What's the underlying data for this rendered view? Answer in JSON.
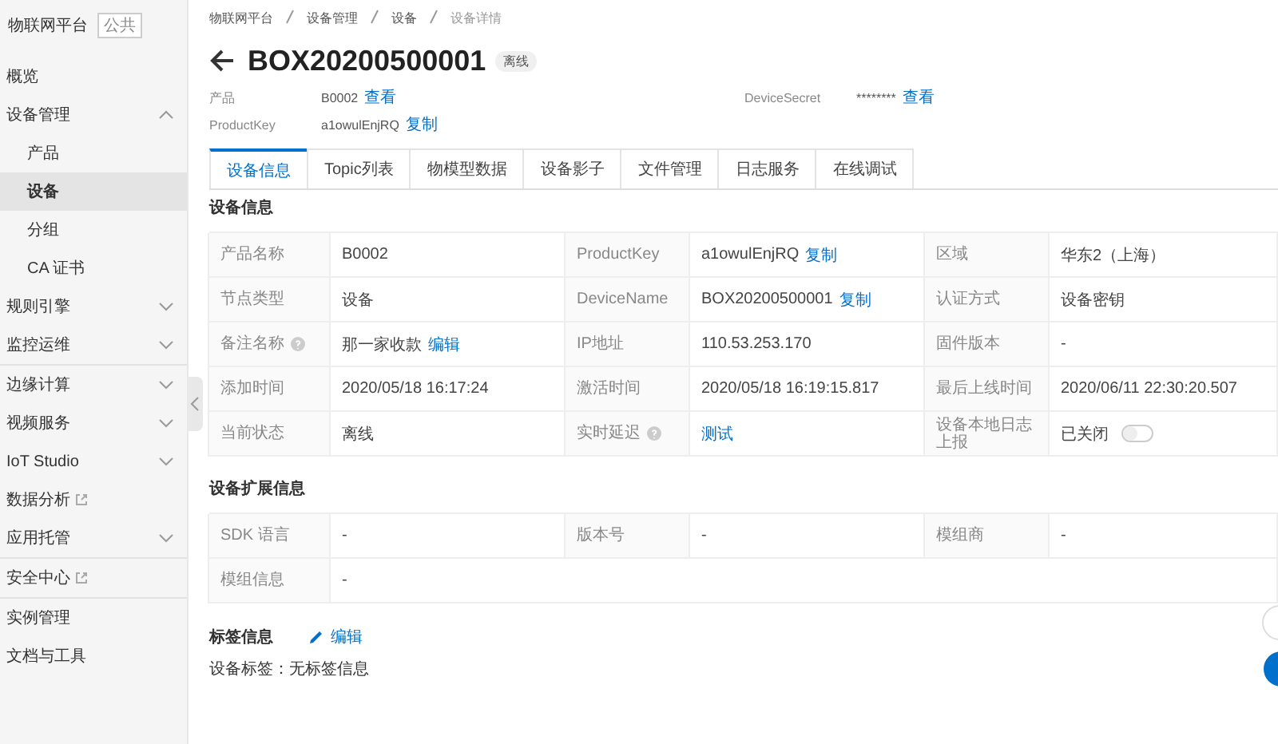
{
  "sidebar": {
    "platform": "物联网平台",
    "platform_badge": "公共",
    "sections": [
      [
        {
          "label": "概览",
          "selected": false
        },
        {
          "label": "设备管理",
          "selected": false,
          "expanded": true,
          "children": [
            {
              "label": "产品",
              "selected": false
            },
            {
              "label": "设备",
              "selected": true
            },
            {
              "label": "分组",
              "selected": false
            },
            {
              "label": "CA 证书",
              "selected": false
            }
          ]
        },
        {
          "label": "规则引擎",
          "selected": false,
          "expanded": false
        },
        {
          "label": "监控运维",
          "selected": false,
          "expanded": false
        }
      ],
      [
        {
          "label": "边缘计算",
          "selected": false,
          "expanded": false
        },
        {
          "label": "视频服务",
          "selected": false,
          "expanded": false
        },
        {
          "label": "IoT Studio",
          "selected": false,
          "expanded": false
        },
        {
          "label": "数据分析",
          "selected": false,
          "external": true
        },
        {
          "label": "应用托管",
          "selected": false,
          "expanded": false
        }
      ],
      [
        {
          "label": "安全中心",
          "selected": false,
          "external": true
        }
      ],
      [
        {
          "label": "实例管理",
          "selected": false
        },
        {
          "label": "文档与工具",
          "selected": false
        }
      ]
    ]
  },
  "breadcrumb": [
    "物联网平台",
    "设备管理",
    "设备",
    "设备详情"
  ],
  "title": "BOX20200500001",
  "status_badge": "离线",
  "meta": [
    {
      "label": "产品",
      "value": "B0002",
      "action": "查看"
    },
    {
      "label": "DeviceSecret",
      "value": "********",
      "action": "查看"
    },
    {
      "label": "ProductKey",
      "value": "a1owulEnjRQ",
      "action": "复制"
    }
  ],
  "tabs": [
    {
      "label": "设备信息",
      "selected": true
    },
    {
      "label": "Topic列表",
      "selected": false
    },
    {
      "label": "物模型数据",
      "selected": false
    },
    {
      "label": "设备影子",
      "selected": false
    },
    {
      "label": "文件管理",
      "selected": false
    },
    {
      "label": "日志服务",
      "selected": false
    },
    {
      "label": "在线调试",
      "selected": false
    }
  ],
  "device_info": {
    "title": "设备信息",
    "rows": [
      [
        {
          "label": "产品名称",
          "kind": "text",
          "value": "B0002"
        },
        {
          "label": "ProductKey",
          "kind": "text",
          "value": "a1owulEnjRQ",
          "action": "复制"
        },
        {
          "label": "区域",
          "kind": "text",
          "value": "华东2（上海）"
        }
      ],
      [
        {
          "label": "节点类型",
          "kind": "text",
          "value": "设备"
        },
        {
          "label": "DeviceName",
          "kind": "text",
          "value": "BOX20200500001",
          "action": "复制"
        },
        {
          "label": "认证方式",
          "kind": "text",
          "value": "设备密钥"
        }
      ],
      [
        {
          "label": "备注名称",
          "help": true,
          "kind": "text",
          "value": "那一家收款",
          "action": "编辑"
        },
        {
          "label": "IP地址",
          "kind": "text",
          "value": "110.53.253.170"
        },
        {
          "label": "固件版本",
          "kind": "text",
          "value": "-"
        }
      ],
      [
        {
          "label": "添加时间",
          "kind": "text",
          "value": "2020/05/18 16:17:24"
        },
        {
          "label": "激活时间",
          "kind": "text",
          "value": "2020/05/18 16:19:15.817"
        },
        {
          "label": "最后上线时间",
          "kind": "text",
          "value": "2020/06/11 22:30:20.507"
        }
      ],
      [
        {
          "label": "当前状态",
          "kind": "text",
          "value": "离线"
        },
        {
          "label": "实时延迟",
          "help": true,
          "kind": "link",
          "value": "测试"
        },
        {
          "label": "设备本地日志上报",
          "kind": "switch",
          "value": "已关闭",
          "on": false
        }
      ]
    ]
  },
  "extended_info": {
    "title": "设备扩展信息",
    "rows": [
      [
        {
          "label": "SDK 语言",
          "kind": "text",
          "value": "-"
        },
        {
          "label": "版本号",
          "kind": "text",
          "value": "-"
        },
        {
          "label": "模组商",
          "kind": "text",
          "value": "-"
        }
      ],
      [
        {
          "label": "模组信息",
          "kind": "text",
          "value": "-"
        }
      ]
    ]
  },
  "tags": {
    "title": "标签信息",
    "action": "编辑",
    "label": "设备标签：",
    "value": "无标签信息"
  }
}
